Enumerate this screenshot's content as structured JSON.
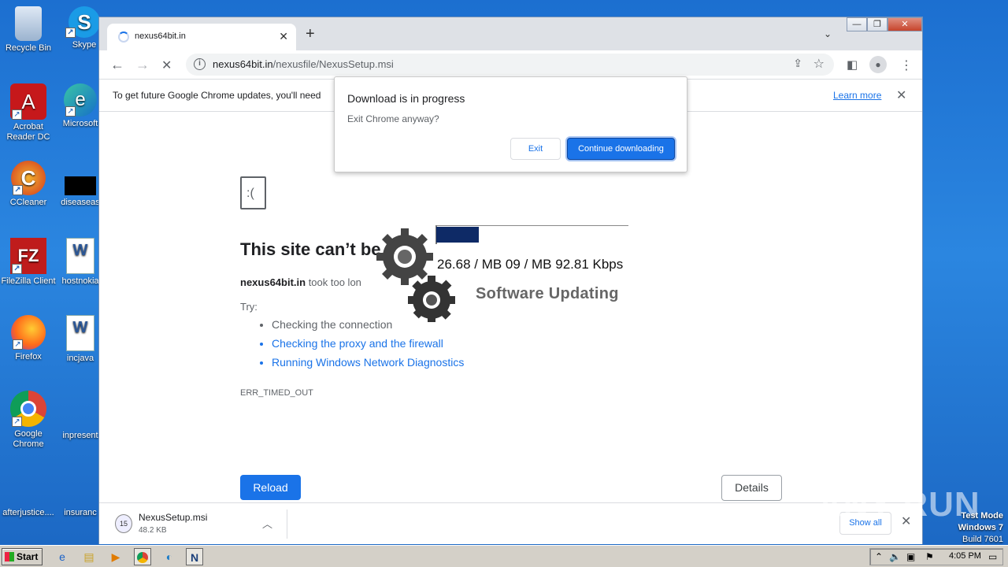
{
  "desktop": {
    "icons": [
      {
        "label": "Recycle Bin",
        "glyph": "🗑"
      },
      {
        "label": "Skype",
        "glyph": "S"
      },
      {
        "label": "Acrobat Reader DC",
        "glyph": "A"
      },
      {
        "label": "Microsoft",
        "glyph": "e"
      },
      {
        "label": "CCleaner",
        "glyph": "C"
      },
      {
        "label": "diseaseas",
        "glyph": ""
      },
      {
        "label": "FileZilla Client",
        "glyph": "FZ"
      },
      {
        "label": "hostnokia",
        "glyph": "W"
      },
      {
        "label": "Firefox",
        "glyph": "🦊"
      },
      {
        "label": "incjava",
        "glyph": "W"
      },
      {
        "label": "Google Chrome",
        "glyph": "◉"
      },
      {
        "label": "inpresent",
        "glyph": ""
      },
      {
        "label": "afterjustice....",
        "glyph": ""
      },
      {
        "label": "insuranc",
        "glyph": ""
      }
    ]
  },
  "chrome": {
    "tab_title": "nexus64bit.in",
    "tab_close": "✕",
    "new_tab": "+",
    "tab_dropdown": "⌄",
    "window_buttons": {
      "minimize": "—",
      "restore": "❐",
      "close": "✕"
    },
    "back": "←",
    "forward": "→",
    "reload": "✕",
    "url_host": "nexus64bit.in",
    "url_path": "/nexusfile/NexusSetup.msi",
    "infobar_message": "To get future Google Chrome updates, you'll need",
    "infobar_link": "Learn more",
    "infobar_close": "✕",
    "menu": "⋮"
  },
  "error_page": {
    "title": "This site can’t be",
    "desc_host": "nexus64bit.in",
    "desc_rest": " took too lon",
    "try_label": "Try:",
    "suggestions": [
      "Checking the connection",
      "Checking the proxy and the firewall",
      "Running Windows Network Diagnostics"
    ],
    "error_code": "ERR_TIMED_OUT",
    "reload_label": "Reload",
    "details_label": "Details"
  },
  "overlay": {
    "speed_text": "26.68 / MB 09 / MB 92.81 Kbps",
    "label": "Software Updating",
    "progress": 0.22
  },
  "dialog": {
    "title": "Download is in progress",
    "subtitle": "Exit Chrome anyway?",
    "exit_label": "Exit",
    "continue_label": "Continue downloading"
  },
  "download_shelf": {
    "file_name": "NexusSetup.msi",
    "file_size": "48.2 KB",
    "show_all": "Show all",
    "close": "✕"
  },
  "watermark": {
    "brand": "ANY RUN",
    "test_mode": "Test Mode",
    "os": "Windows 7",
    "build": "Build 7601"
  },
  "taskbar": {
    "start_label": "Start",
    "clock": "4:05 PM"
  }
}
